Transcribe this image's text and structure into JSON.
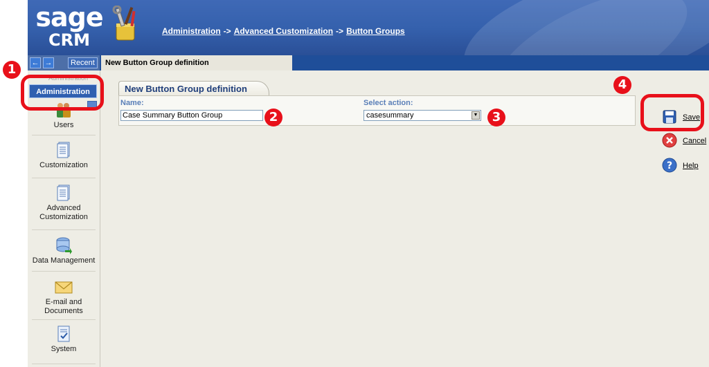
{
  "brand": {
    "line1": "sage",
    "line2": "CRM"
  },
  "breadcrumb": {
    "items": [
      "Administration",
      "Advanced Customization",
      "Button Groups"
    ],
    "separator": "->"
  },
  "nav": {
    "back": "←",
    "forward": "→",
    "recent": "Recent"
  },
  "page_tab": "New Button Group definition",
  "sidebar": {
    "ghost_text": "Administration",
    "active": "Administration",
    "items": [
      {
        "label": "Users",
        "icon": "users-icon"
      },
      {
        "label": "Customization",
        "icon": "document-icon"
      },
      {
        "label": "Advanced Customization",
        "icon": "document-icon"
      },
      {
        "label": "Data Management",
        "icon": "database-icon"
      },
      {
        "label": "E-mail and Documents",
        "icon": "envelope-icon"
      },
      {
        "label": "System",
        "icon": "checklist-icon"
      }
    ]
  },
  "form": {
    "tab_title": "New Button Group definition",
    "name_label": "Name:",
    "name_value": "Case Summary Button Group",
    "action_label": "Select action:",
    "action_value": "casesummary"
  },
  "actions": [
    {
      "label": "Save",
      "icon": "save-icon"
    },
    {
      "label": "Cancel",
      "icon": "cancel-icon"
    },
    {
      "label": "Help",
      "icon": "help-icon"
    }
  ],
  "callouts": [
    "1",
    "2",
    "3",
    "4"
  ],
  "colors": {
    "header_blue": "#3561ad",
    "nav_strip": "#1f4e99",
    "accent_red": "#e8101a",
    "background": "#eeede5"
  }
}
